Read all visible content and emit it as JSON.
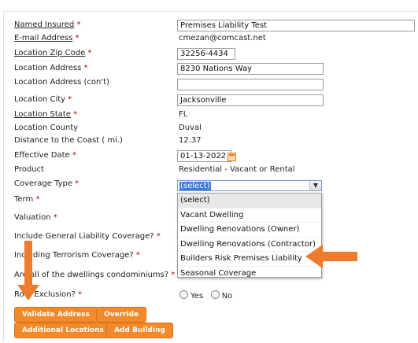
{
  "fields": {
    "named_insured": {
      "label": "Named Insured",
      "value": "Premises Liability Test"
    },
    "email": {
      "label": "E-mail Address",
      "value": "cmezan@comcast.net"
    },
    "zip": {
      "label": "Location Zip Code",
      "value": "32256-4434"
    },
    "address": {
      "label": "Location Address",
      "value": "8230 Nations Way"
    },
    "address2": {
      "label": "Location Address (con't)",
      "value": ""
    },
    "city": {
      "label": "Location City",
      "value": "Jacksonville"
    },
    "state": {
      "label": "Location State",
      "value": "FL"
    },
    "county": {
      "label": "Location County",
      "value": "Duval"
    },
    "coast": {
      "label": "Distance to the Coast ( mi.)",
      "value": "12.37"
    },
    "effective_date": {
      "label": "Effective Date",
      "value": "01-13-2022"
    },
    "product": {
      "label": "Product",
      "value": "Residential - Vacant or Rental"
    },
    "coverage_type": {
      "label": "Coverage Type",
      "value": "(select)"
    },
    "term": {
      "label": "Term"
    },
    "valuation": {
      "label": "Valuation"
    },
    "general_liability": {
      "label": "Include General Liability Coverage?"
    },
    "terrorism": {
      "label": "Including Terrorism Coverage?"
    },
    "condos": {
      "label": "Are all of the dwellings condominiums?"
    },
    "roof": {
      "label": "Roof Exclusion?",
      "yes": "Yes",
      "no": "No"
    }
  },
  "required_marker": "*",
  "coverage_options": [
    "(select)",
    "Vacant Dwelling",
    "Dwelling Renovations (Owner)",
    "Dwelling Renovations (Contractor)",
    "Builders Risk Premises Liability",
    "Seasonal Coverage"
  ],
  "buttons": {
    "validate": "Validate Address",
    "override": "Override",
    "additional": "Additional Locations",
    "add_building": "Add Building"
  },
  "colors": {
    "accent": "#f28a2b",
    "arrow": "#ee7c2c",
    "required": "#b00000"
  }
}
